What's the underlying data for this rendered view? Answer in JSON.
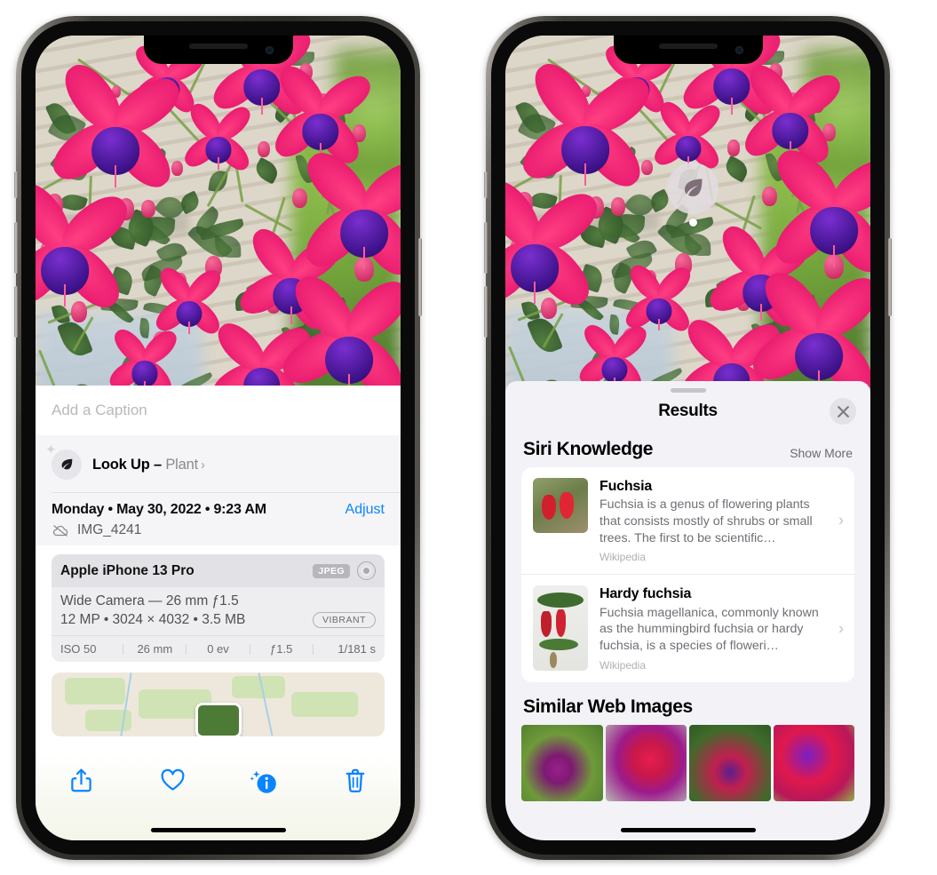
{
  "left_phone": {
    "caption_placeholder": "Add a Caption",
    "lookup": {
      "label": "Look Up – ",
      "subject": "Plant",
      "chevron": "›",
      "icon": "leaf-icon"
    },
    "date_line": "Monday • May 30, 2022 • 9:23 AM",
    "adjust_label": "Adjust",
    "filename": "IMG_4241",
    "cloud_icon": "cloud-slash-icon",
    "exif": {
      "device": "Apple iPhone 13 Pro",
      "format_badge": "JPEG",
      "hdr_icon": "hdr-circle-icon",
      "lens_line": "Wide Camera — 26 mm ƒ1.5",
      "spec_line": "12 MP • 3024 × 4032 • 3.5 MB",
      "style_badge": "VIBRANT",
      "stats": [
        "ISO 50",
        "26 mm",
        "0 ev",
        "ƒ1.5",
        "1/181 s"
      ]
    },
    "toolbar": [
      {
        "name": "share-icon",
        "label": "Share"
      },
      {
        "name": "heart-icon",
        "label": "Favorite"
      },
      {
        "name": "info-sparkle-icon",
        "label": "Info"
      },
      {
        "name": "trash-icon",
        "label": "Delete"
      }
    ]
  },
  "right_phone": {
    "visual_lookup_badge": "leaf-icon",
    "sheet_title": "Results",
    "close_icon": "close-icon",
    "sections": [
      {
        "title": "Siri Knowledge",
        "action": "Show More",
        "cards": [
          {
            "title": "Fuchsia",
            "description": "Fuchsia is a genus of flowering plants that consists mostly of shrubs or small trees. The first to be scientific…",
            "source": "Wikipedia",
            "chevron": "›"
          },
          {
            "title": "Hardy fuchsia",
            "description": "Fuchsia magellanica, commonly known as the hummingbird fuchsia or hardy fuchsia, is a species of floweri…",
            "source": "Wikipedia",
            "chevron": "›"
          }
        ]
      },
      {
        "title": "Similar Web Images",
        "thumbs": [
          "web-image-1",
          "web-image-2",
          "web-image-3",
          "web-image-4"
        ]
      }
    ]
  },
  "colors": {
    "accent_blue": "#0a84ff",
    "sheet_gray": "#f2f2f7",
    "card_white": "#ffffff",
    "secondary_text": "#6f6f76"
  }
}
